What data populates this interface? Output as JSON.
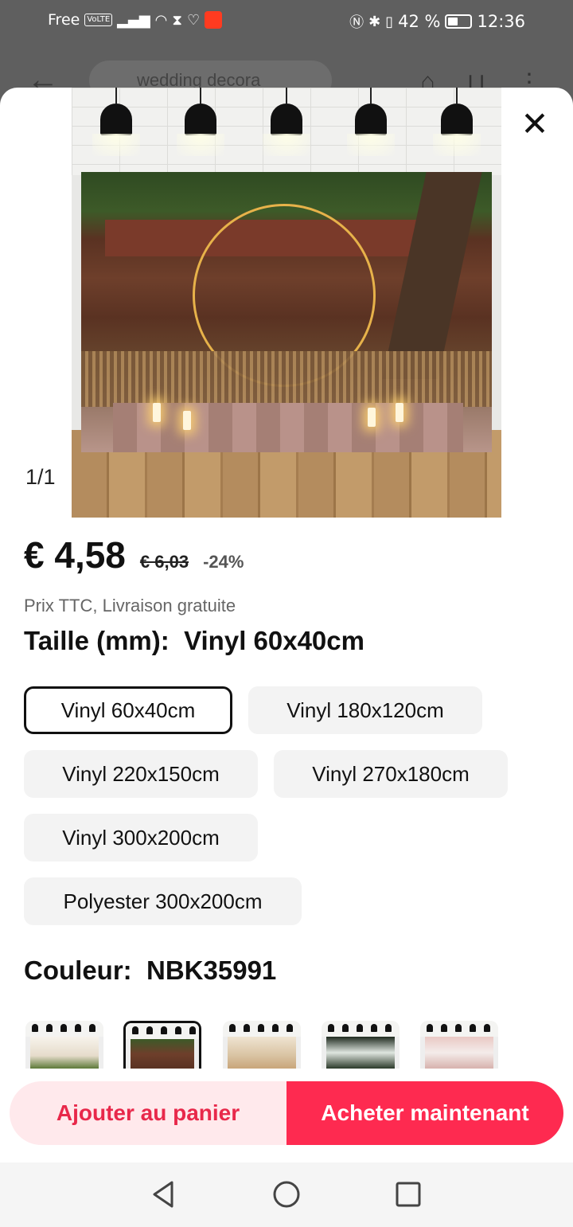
{
  "status_bar": {
    "carrier": "Free",
    "volte": "VoLTE",
    "battery": "42 %",
    "time": "12:36"
  },
  "background_header": {
    "search_text": "wedding decora"
  },
  "sheet": {
    "close_icon": "close-icon",
    "image_counter": "1/1",
    "price": "€ 4,58",
    "original_price": "€ 6,03",
    "discount": "-24%",
    "tax_note": "Prix TTC, Livraison gratuite",
    "size_label": "Taille (mm):",
    "size_selected": "Vinyl 60x40cm",
    "size_options": [
      "Vinyl 60x40cm",
      "Vinyl 180x120cm",
      "Vinyl 220x150cm",
      "Vinyl 270x180cm",
      "Vinyl 300x200cm",
      "Polyester 300x200cm"
    ],
    "color_label": "Couleur:",
    "color_selected": "NBK35991"
  },
  "actions": {
    "add_to_cart": "Ajouter au panier",
    "buy_now": "Acheter maintenant"
  },
  "colors": {
    "accent": "#fe2a50",
    "accent_light": "#ffe9ec"
  }
}
